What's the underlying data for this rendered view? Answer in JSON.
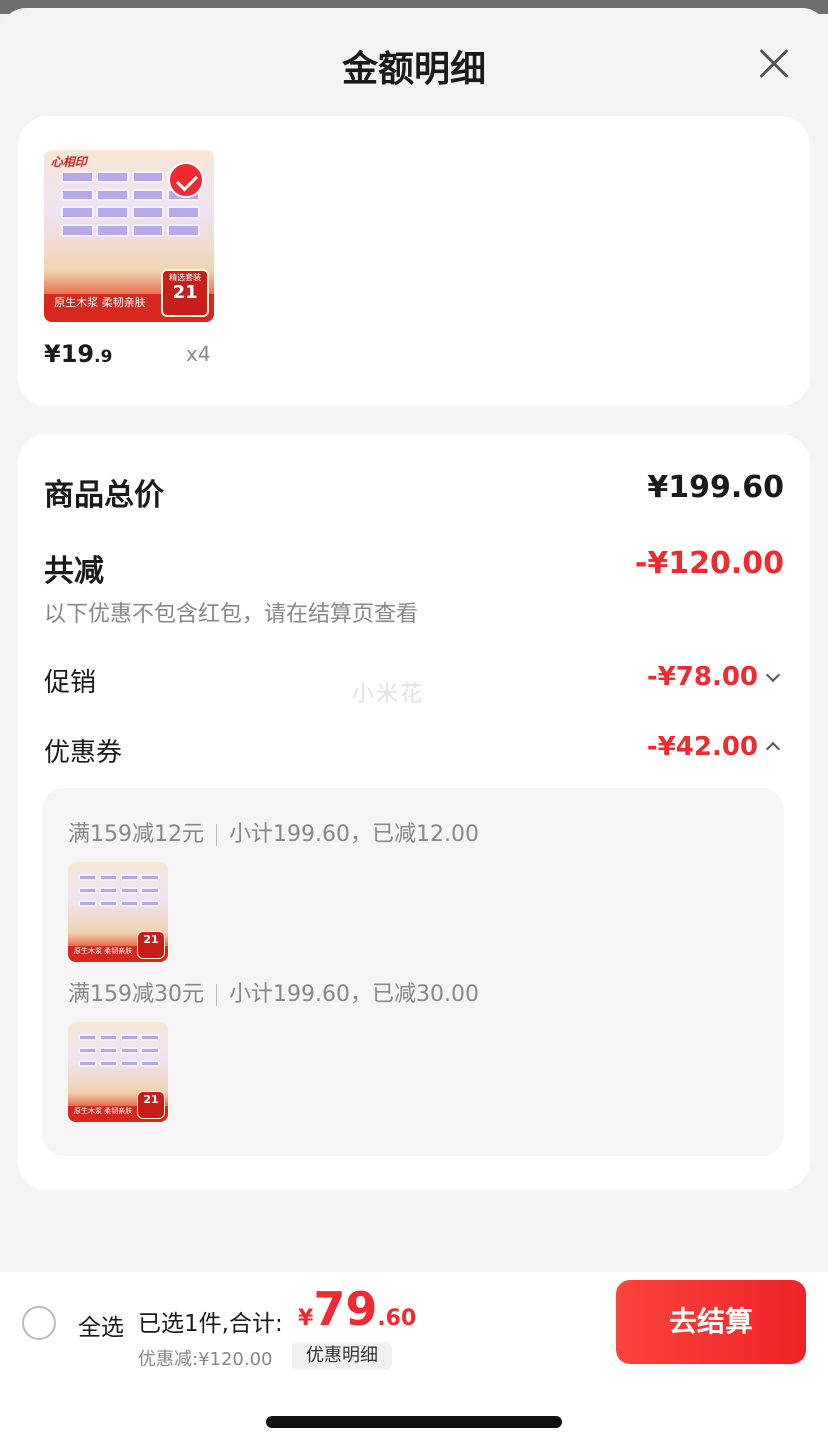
{
  "sheet": {
    "title": "金额明细",
    "close_icon": "close-icon"
  },
  "product": {
    "brand": "心相印",
    "banner_text": "原生木浆 柔韧亲肤",
    "badge_top": "精选套装",
    "badge_count": "21",
    "badge_unit": "包",
    "selected": true,
    "price_main": "¥19",
    "price_decimal": ".9",
    "quantity": "x4"
  },
  "breakdown": {
    "total_label": "商品总价",
    "total_value": "¥199.60",
    "reduce_label": "共减",
    "reduce_value": "-¥120.00",
    "reduce_note": "以下优惠不包含红包，请在结算页查看",
    "promo_label": "促销",
    "promo_value": "-¥78.00",
    "coupon_label": "优惠券",
    "coupon_value": "-¥42.00",
    "watermark": "小米花"
  },
  "coupons": [
    {
      "rule": "满159减12元",
      "detail": "小计199.60，已减12.00"
    },
    {
      "rule": "满159减30元",
      "detail": "小计199.60，已减30.00"
    }
  ],
  "bottom": {
    "select_all": "全选",
    "summary": "已选1件,合计:",
    "currency": "¥",
    "total_int": "79",
    "total_dec": ".60",
    "discount": "优惠减:¥120.00",
    "detail_button": "优惠明细",
    "checkout_button": "去结算"
  },
  "colors": {
    "accent": "#ef2b31",
    "muted": "#888888"
  }
}
